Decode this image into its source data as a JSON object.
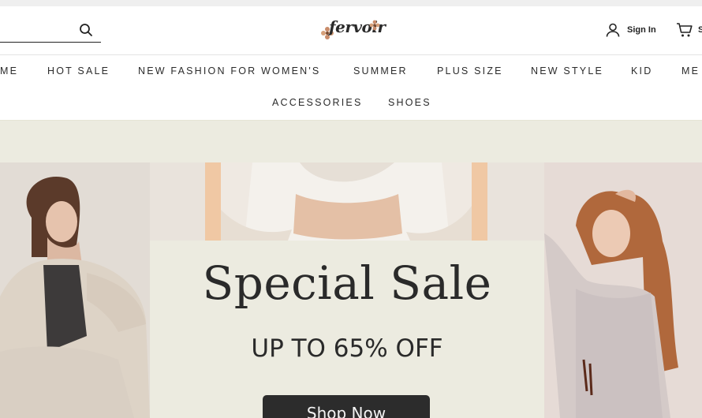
{
  "brand": {
    "logo_text": "fervoir"
  },
  "header": {
    "search": {
      "placeholder": "",
      "value": ""
    },
    "signin_label": "Sign In",
    "cart_label": "S"
  },
  "nav": {
    "row1": [
      {
        "label": "ME"
      },
      {
        "label": "HOT SALE"
      },
      {
        "label": "NEW FASHION FOR WOMEN'S"
      },
      {
        "label": "SUMMER"
      },
      {
        "label": "PLUS SIZE"
      },
      {
        "label": "NEW STYLE"
      },
      {
        "label": "KID"
      },
      {
        "label": "ME"
      }
    ],
    "row2": [
      {
        "label": "ACCESSORIES"
      },
      {
        "label": "SHOES"
      }
    ]
  },
  "hero": {
    "title": "Special Sale",
    "subtitle": "UP TO 65% OFF",
    "button_label": "Shop Now"
  },
  "colors": {
    "banner_background": "#ecebe0",
    "button": "#2c2c2c",
    "text": "#2a2a2a"
  }
}
